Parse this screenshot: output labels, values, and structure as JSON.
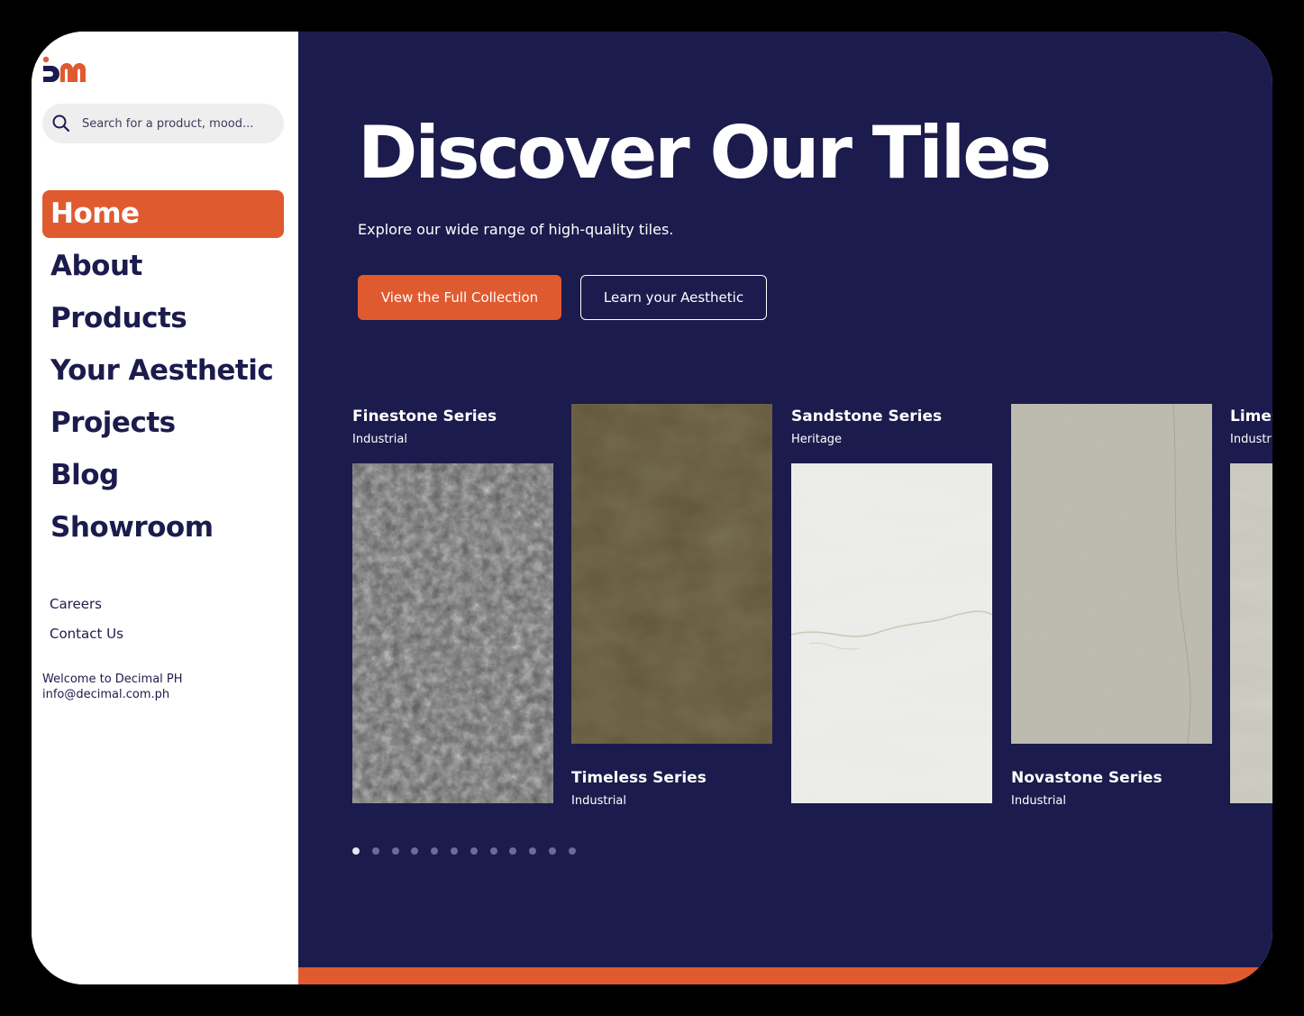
{
  "brand": {
    "logo_icon": "decimal-logo",
    "colors": {
      "navy": "#1c1b4d",
      "orange": "#e05a30",
      "white": "#ffffff"
    }
  },
  "search": {
    "placeholder": "Search for a product, mood...",
    "icon": "search-icon"
  },
  "nav": {
    "items": [
      {
        "label": "Home",
        "active": true
      },
      {
        "label": "About"
      },
      {
        "label": "Products"
      },
      {
        "label": "Your Aesthetic"
      },
      {
        "label": "Projects"
      },
      {
        "label": "Blog"
      },
      {
        "label": "Showroom"
      }
    ]
  },
  "secondary_nav": {
    "careers": "Careers",
    "contact": "Contact Us"
  },
  "info": {
    "welcome": "Welcome to Decimal PH",
    "email": "info@decimal.com.ph"
  },
  "hero": {
    "title": "Discover Our Tiles",
    "subtitle": "Explore our wide range of high-quality tiles.",
    "primary_button": "View the Full Collection",
    "secondary_button": "Learn your Aesthetic"
  },
  "products": [
    {
      "name": "Finestone Series",
      "category": "Industrial",
      "texture": "terrazzo-gray"
    },
    {
      "name": "Timeless Series",
      "category": "Industrial",
      "texture": "olive-brown"
    },
    {
      "name": "Sandstone Series",
      "category": "Heritage",
      "texture": "white-marble"
    },
    {
      "name": "Novastone Series",
      "category": "Industrial",
      "texture": "beige-stone"
    },
    {
      "name": "Limestone Series",
      "category": "Industrial",
      "texture": "light-limestone"
    }
  ],
  "carousel": {
    "total_pages": 12,
    "active_page": 1
  }
}
